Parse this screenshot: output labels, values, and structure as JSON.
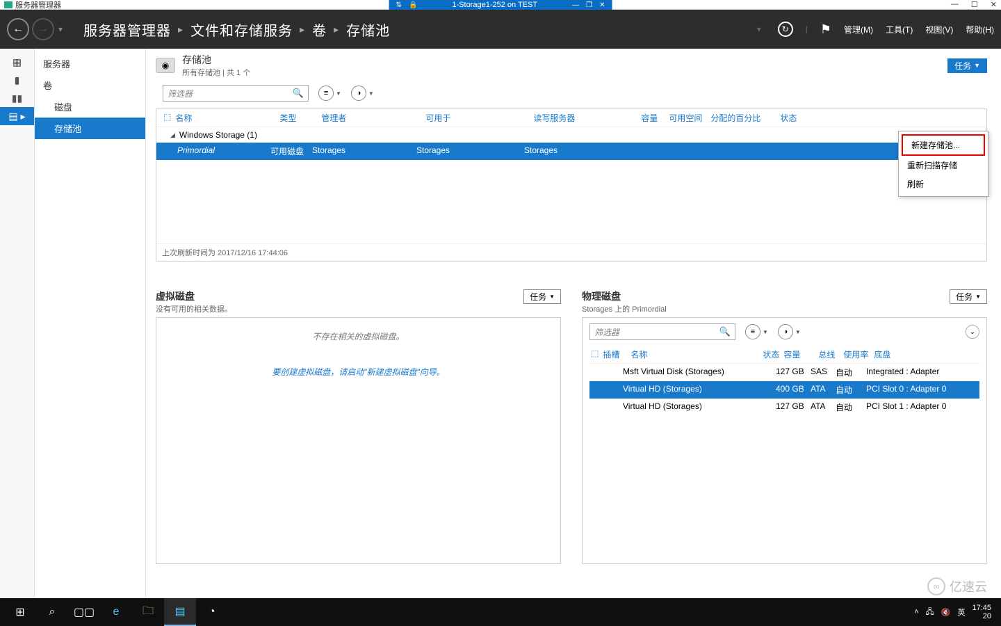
{
  "vm": {
    "app_title": "服务器管理器",
    "conn_title": "1-Storage1-252 on TEST"
  },
  "header": {
    "breadcrumb": [
      "服务器管理器",
      "文件和存储服务",
      "卷",
      "存储池"
    ],
    "menus": {
      "manage": "管理(M)",
      "tools": "工具(T)",
      "view": "视图(V)",
      "help": "帮助(H)"
    }
  },
  "sidenav": {
    "servers": "服务器",
    "volumes": "卷",
    "disks": "磁盘",
    "pools": "存储池"
  },
  "pool_section": {
    "title": "存储池",
    "subtitle": "所有存储池 | 共 1 个",
    "tasks_label": "任务",
    "filter_placeholder": "筛选器",
    "columns": {
      "name": "名称",
      "type": "类型",
      "mgr": "管理者",
      "avail": "可用于",
      "rw": "读写服务器",
      "cap": "容量",
      "free": "可用空间",
      "pct": "分配的百分比",
      "stat": "状态"
    },
    "group": "Windows Storage (1)",
    "row": {
      "name": "Primordial",
      "type": "可用磁盘",
      "mgr": "Storages",
      "avail": "Storages",
      "rw": "Storages"
    },
    "footer": "上次刷新时间为 2017/12/16 17:44:06"
  },
  "ctx": {
    "new_pool": "新建存储池...",
    "rescan": "重新扫描存储",
    "refresh": "刷新"
  },
  "vd": {
    "title": "虚拟磁盘",
    "sub": "没有可用的相关数据。",
    "tasks": "任务",
    "empty": "不存在相关的虚拟磁盘。",
    "link": "要创建虚拟磁盘，请启动\"新建虚拟磁盘\"向导。"
  },
  "pd": {
    "title": "物理磁盘",
    "sub": "Storages 上的 Primordial",
    "tasks": "任务",
    "filter_placeholder": "筛选器",
    "columns": {
      "slot": "插槽",
      "name": "名称",
      "stat": "状态",
      "cap": "容量",
      "bus": "总线",
      "use": "使用率",
      "chas": "底盘"
    },
    "rows": [
      {
        "name": "Msft Virtual Disk (Storages)",
        "cap": "127 GB",
        "bus": "SAS",
        "use": "自动",
        "chas": "Integrated : Adapter"
      },
      {
        "name": "Virtual HD (Storages)",
        "cap": "400 GB",
        "bus": "ATA",
        "use": "自动",
        "chas": "PCI Slot 0 : Adapter 0"
      },
      {
        "name": "Virtual HD (Storages)",
        "cap": "127 GB",
        "bus": "ATA",
        "use": "自动",
        "chas": "PCI Slot 1 : Adapter 0"
      }
    ]
  },
  "tray": {
    "ime": "英",
    "time": "17:45",
    "date_pre": "20"
  },
  "watermark": "亿速云"
}
